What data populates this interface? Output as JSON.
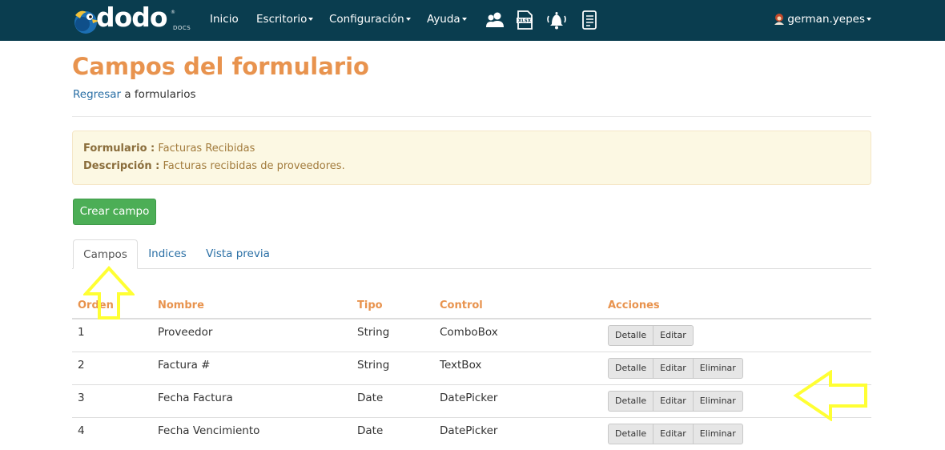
{
  "navbar": {
    "logo_text": "dodo",
    "logo_suffix": "DOCS",
    "logo_reg": "®",
    "items": [
      {
        "label": "Inicio",
        "has_caret": false
      },
      {
        "label": "Escritorio",
        "has_caret": true
      },
      {
        "label": "Configuración",
        "has_caret": true
      },
      {
        "label": "Ayuda",
        "has_caret": true
      }
    ],
    "icons": [
      "users-icon",
      "xlsx-file-icon",
      "notification-bell-icon",
      "document-list-icon"
    ],
    "user": "german.yepes"
  },
  "page": {
    "title": "Campos del formulario",
    "back_link": "Regresar",
    "back_suffix": " a formularios"
  },
  "info": {
    "form_label": "Formulario :",
    "form_value": " Facturas Recibidas",
    "desc_label": "Descripción :",
    "desc_value": " Facturas recibidas de proveedores."
  },
  "create_button": "Crear campo",
  "tabs": [
    {
      "label": "Campos",
      "active": true
    },
    {
      "label": "Indices",
      "active": false
    },
    {
      "label": "Vista previa",
      "active": false
    }
  ],
  "table": {
    "headers": {
      "orden": "Orden",
      "nombre": "Nombre",
      "tipo": "Tipo",
      "control": "Control",
      "acciones": "Acciones"
    },
    "rows": [
      {
        "orden": "1",
        "nombre": "Proveedor",
        "tipo": "String",
        "control": "ComboBox",
        "actions": [
          "Detalle",
          "Editar"
        ]
      },
      {
        "orden": "2",
        "nombre": "Factura #",
        "tipo": "String",
        "control": "TextBox",
        "actions": [
          "Detalle",
          "Editar",
          "Eliminar"
        ]
      },
      {
        "orden": "3",
        "nombre": "Fecha Factura",
        "tipo": "Date",
        "control": "DatePicker",
        "actions": [
          "Detalle",
          "Editar",
          "Eliminar"
        ]
      },
      {
        "orden": "4",
        "nombre": "Fecha Vencimiento",
        "tipo": "Date",
        "control": "DatePicker",
        "actions": [
          "Detalle",
          "Editar",
          "Eliminar"
        ]
      }
    ]
  },
  "colors": {
    "navbar": "#0a3d4f",
    "accent": "#e8934e",
    "link": "#2a6fa5",
    "create_button": "#4cae56",
    "annotation_arrow": "#ffff33"
  }
}
